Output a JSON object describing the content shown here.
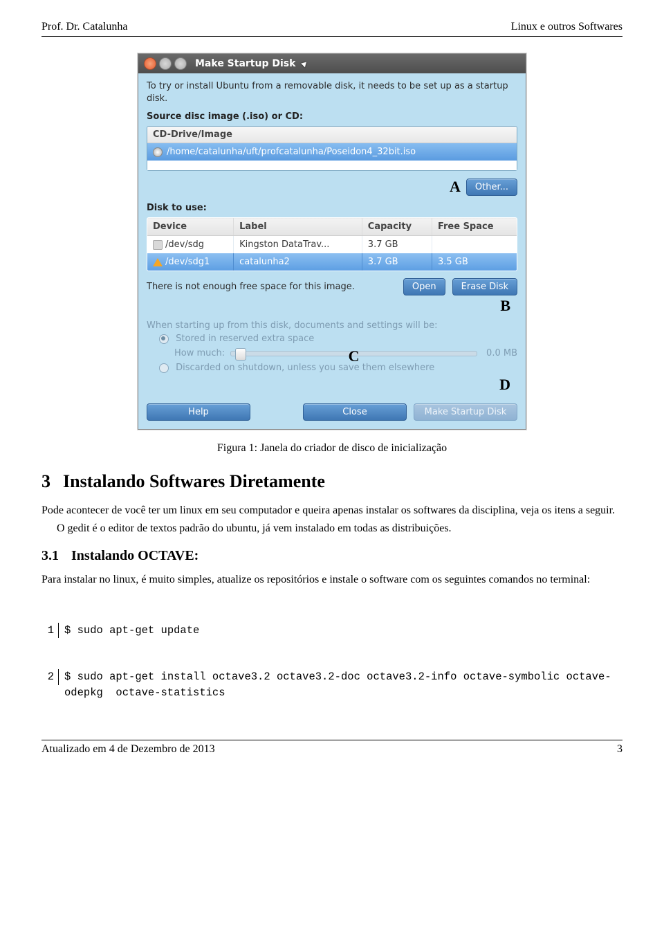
{
  "header": {
    "left": "Prof. Dr. Catalunha",
    "right": "Linux e outros Softwares"
  },
  "footer": {
    "left": "Atualizado em 4 de Dezembro de 2013",
    "right": "3"
  },
  "figure": {
    "caption": "Figura 1: Janela do criador de disco de inicialização",
    "titlebar": {
      "title": "Make Startup Disk"
    },
    "intro": "To try or install Ubuntu from a removable disk, it needs to be set up as a startup disk.",
    "source_label": "Source disc image (.iso) or CD:",
    "iso_header": "CD-Drive/Image",
    "iso_selected": "/home/catalunha/uft/profcatalunha/Poseidon4_32bit.iso",
    "annotation_A": "A",
    "other_btn": "Other...",
    "disk_label": "Disk to use:",
    "columns": {
      "device": "Device",
      "label": "Label",
      "capacity": "Capacity",
      "free": "Free Space"
    },
    "rows": [
      {
        "device": "/dev/sdg",
        "label": "Kingston DataTrav...",
        "capacity": "3.7 GB",
        "free": "",
        "selected": false,
        "icon": "disk"
      },
      {
        "device": "/dev/sdg1",
        "label": "catalunha2",
        "capacity": "3.7 GB",
        "free": "3.5 GB",
        "selected": true,
        "icon": "warn"
      }
    ],
    "status_msg": "There is not enough free space for this image.",
    "open_btn": "Open",
    "erase_btn": "Erase Disk",
    "annotation_B": "B",
    "pers_intro": "When starting up from this disk, documents and settings will be:",
    "opt_stored": "Stored in reserved extra space",
    "howmuch": "How much:",
    "annotation_C": "C",
    "slider_end": "0.0 MB",
    "opt_discard": "Discarded on shutdown, unless you save them elsewhere",
    "annotation_D": "D",
    "help_btn": "Help",
    "close_btn": "Close",
    "make_btn": "Make Startup Disk"
  },
  "section3": {
    "num": "3",
    "title": "Instalando Softwares Diretamente",
    "p1": "Pode acontecer de você ter um linux em seu computador e queira apenas instalar os softwares da disciplina, veja os itens a seguir.",
    "p2": "O gedit é o editor de textos padrão do ubuntu, já vem instalado em todas as distribuições."
  },
  "section31": {
    "num": "3.1",
    "title": "Instalando OCTAVE:",
    "p1": "Para instalar no linux, é muito simples, atualize os repositórios e instale o software com os seguintes comandos no terminal:",
    "code": [
      "$ sudo apt-get update",
      "$ sudo apt-get install octave3.2 octave3.2-doc octave3.2-info octave-symbolic octave-odepkg  octave-statistics"
    ]
  }
}
